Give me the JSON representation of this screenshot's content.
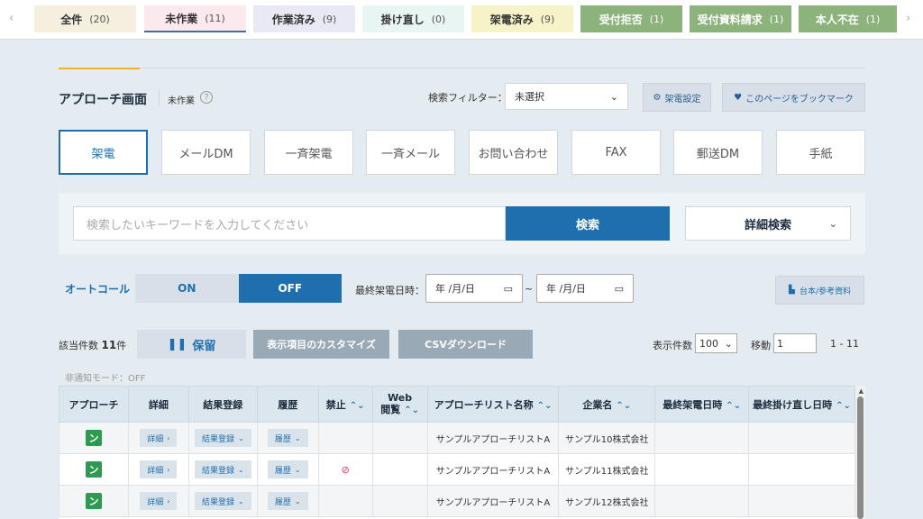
{
  "tabs": [
    {
      "label": "全件",
      "count": "(20)"
    },
    {
      "label": "未作業",
      "count": "(11)"
    },
    {
      "label": "作業済み",
      "count": "(9)"
    },
    {
      "label": "掛け直し",
      "count": "(0)"
    },
    {
      "label": "架電済み",
      "count": "(9)"
    },
    {
      "label": "受付拒否",
      "count": "(1)"
    },
    {
      "label": "受付資料請求",
      "count": "(1)"
    },
    {
      "label": "本人不在",
      "count": "(1)"
    }
  ],
  "tab_colors": {
    "all": "#f5efe0",
    "todo": "#fbe9ee",
    "done": "#e9e9f6",
    "retry": "#e8f5f2",
    "called": "#f6f3c8",
    "reject": "#8bb37b",
    "docs": "#8bb37b",
    "absent": "#8bb37b"
  },
  "header": {
    "title": "アプローチ画面",
    "subtitle": "未作業",
    "help_icon": "?",
    "filter_label": "検索フィルター：",
    "filter_value": "未選択",
    "settings_label": "架電設定",
    "bookmark_label": "このページをブックマーク"
  },
  "channels": [
    "架電",
    "メールDM",
    "一斉架電",
    "一斉メール",
    "お問い合わせ",
    "FAX",
    "郵送DM",
    "手紙"
  ],
  "search": {
    "placeholder": "検索したいキーワードを入力してください",
    "button": "検索",
    "advanced": "詳細検索"
  },
  "autocall": {
    "label": "オートコール",
    "on": "ON",
    "off": "OFF",
    "date_label": "最終架電日時：",
    "date_placeholder": "年 /月/日",
    "tilde": "~",
    "ref_button": "台本/参考資料"
  },
  "toolbar": {
    "count_prefix": "該当件数",
    "count_value": "11",
    "count_suffix": "件",
    "hold": "保留",
    "customize": "表示項目のカスタマイズ",
    "csv": "CSVダウンロード",
    "per_page_label": "表示件数",
    "per_page_value": "100",
    "move_label": "移動",
    "move_value": "1",
    "range": "1 - 11"
  },
  "notify_mode": "非通知モード：OFF",
  "table": {
    "headers": [
      "アプローチ",
      "詳細",
      "結果登録",
      "履歴",
      "禁止",
      "Web\n閲覧",
      "アプローチリスト名称",
      "企業名",
      "最終架電日時",
      "最終掛け直し日時"
    ],
    "detail_label": "詳細",
    "result_label": "結果登録",
    "history_label": "履歴",
    "rows": [
      {
        "prohibited": false,
        "list_name": "サンプルアプローチリストA",
        "company": "サンプル10株式会社",
        "last_call": "",
        "last_retry": ""
      },
      {
        "prohibited": true,
        "list_name": "サンプルアプローチリストA",
        "company": "サンプル11株式会社",
        "last_call": "",
        "last_retry": ""
      },
      {
        "prohibited": false,
        "list_name": "サンプルアプローチリストA",
        "company": "サンプル12株式会社",
        "last_call": "",
        "last_retry": ""
      }
    ]
  }
}
